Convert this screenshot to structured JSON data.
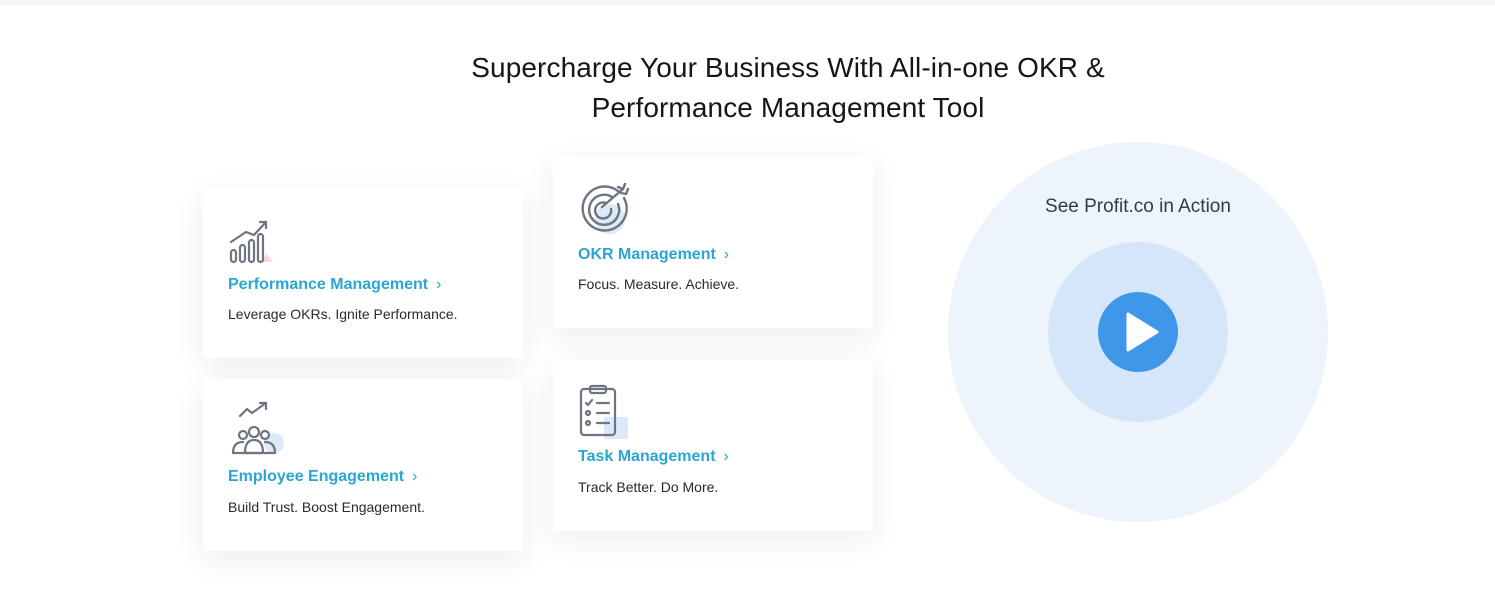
{
  "heading": {
    "line1": "Supercharge Your Business With All-in-one OKR &",
    "line2": "Performance Management Tool"
  },
  "cards": {
    "performance": {
      "title": "Performance Management",
      "chevron": "›",
      "subtitle": "Leverage OKRs. Ignite Performance.",
      "icon": "bar-chart-growth-icon"
    },
    "okr": {
      "title": "OKR Management",
      "chevron": "›",
      "subtitle": "Focus. Measure. Achieve.",
      "icon": "target-arrow-icon"
    },
    "employee": {
      "title": "Employee Engagement",
      "chevron": "›",
      "subtitle": "Build Trust. Boost Engagement.",
      "icon": "team-growth-icon"
    },
    "task": {
      "title": "Task Management",
      "chevron": "›",
      "subtitle": "Track Better. Do More.",
      "icon": "clipboard-checklist-icon"
    }
  },
  "video": {
    "caption": "See Profit.co in Action",
    "icon": "play-icon"
  },
  "colors": {
    "accent": "#29a6d4",
    "play": "#3f97ea",
    "circle_outer": "#edf4fc",
    "circle_inner": "#d5e6fa"
  }
}
